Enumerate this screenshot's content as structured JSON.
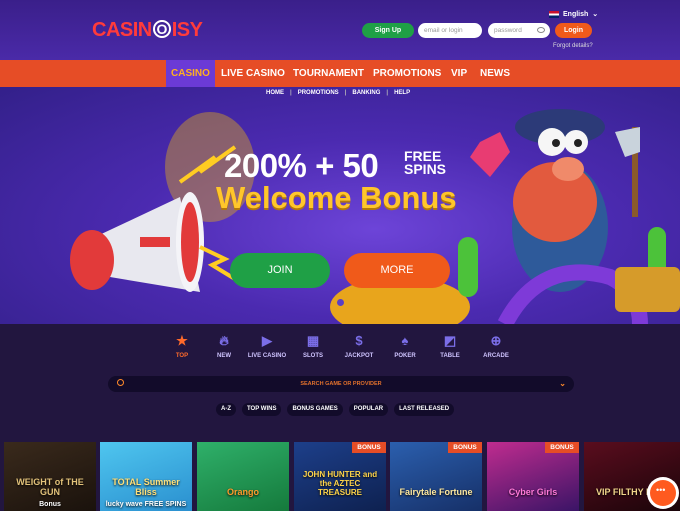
{
  "logo": {
    "part1": "CASIN",
    "part2": "O",
    "part3": "ISY"
  },
  "header": {
    "language": "English",
    "signup_label": "Sign Up",
    "email_placeholder": "email or login",
    "password_placeholder": "password",
    "login_label": "Login",
    "forgot_label": "Forgot details?"
  },
  "nav": [
    "CASINO",
    "LIVE CASINO",
    "TOURNAMENT",
    "PROMOTIONS",
    "VIP",
    "NEWS"
  ],
  "subnav": [
    "HOME",
    "PROMOTIONS",
    "BANKING",
    "HELP"
  ],
  "hero": {
    "headline": "200% + 50",
    "free": "FREE",
    "spins": "SPINS",
    "welcome": "Welcome Bonus",
    "join_label": "JOIN",
    "more_label": "MORE"
  },
  "categories": [
    {
      "label": "TOP",
      "icon": "star-icon"
    },
    {
      "label": "NEW",
      "icon": "flame-icon"
    },
    {
      "label": "LIVE CASINO",
      "icon": "play-icon"
    },
    {
      "label": "SLOTS",
      "icon": "slot-machine-icon"
    },
    {
      "label": "JACKPOT",
      "icon": "dollar-icon"
    },
    {
      "label": "POKER",
      "icon": "spade-icon"
    },
    {
      "label": "TABLE",
      "icon": "table-icon"
    },
    {
      "label": "ARCADE",
      "icon": "gamepad-icon"
    }
  ],
  "search": {
    "placeholder": "SEARCH GAME OR PROVIDER"
  },
  "filters": [
    "A-Z",
    "TOP WINS",
    "BONUS GAMES",
    "POPULAR",
    "LAST RELEASED"
  ],
  "games": [
    {
      "title": "WEIGHT of THE GUN",
      "sub": "Bonus",
      "badge": ""
    },
    {
      "title": "TOTAL Summer Bliss",
      "sub": "lucky wave FREE SPINS",
      "badge": ""
    },
    {
      "title": "Orango",
      "sub": "",
      "badge": ""
    },
    {
      "title": "JOHN HUNTER and the AZTEC TREASURE",
      "sub": "",
      "badge": "BONUS"
    },
    {
      "title": "Fairytale Fortune",
      "sub": "",
      "badge": "BONUS"
    },
    {
      "title": "Cyber Girls",
      "sub": "",
      "badge": "BONUS"
    },
    {
      "title": "VIP FILTHY RICH",
      "sub": "",
      "badge": ""
    }
  ]
}
